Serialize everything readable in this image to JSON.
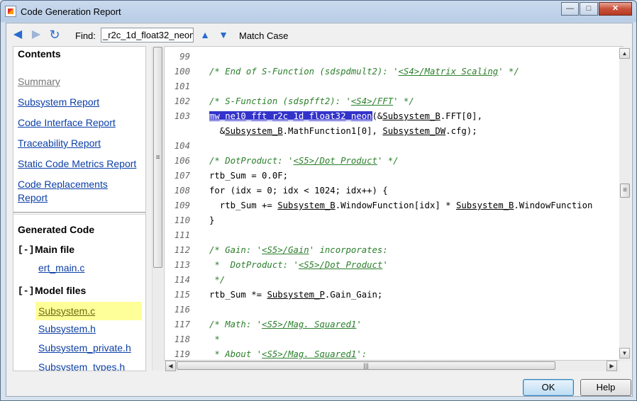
{
  "window": {
    "title": "Code Generation Report",
    "min_label": "—",
    "max_label": "□",
    "close_label": "✕"
  },
  "toolbar": {
    "find_label": "Find:",
    "find_value": "_r2c_1d_float32_neon",
    "match_case_label": "Match Case",
    "back_icon": "◀",
    "forward_icon": "▶",
    "refresh_icon": "↻",
    "up_icon": "▲",
    "down_icon": "▼"
  },
  "contents": {
    "title": "Contents",
    "summary": "Summary",
    "subsystem_report": "Subsystem Report",
    "code_interface_report": "Code Interface Report",
    "traceability_report": "Traceability Report",
    "static_code_metrics_report": "Static Code Metrics Report",
    "code_replacements_line1": "Code Replacements",
    "code_replacements_line2": "Report"
  },
  "generated_code": {
    "title": "Generated Code",
    "main_toggle": "[-]",
    "main_label": "Main file",
    "main_files": [
      "ert_main.c"
    ],
    "model_toggle": "[-]",
    "model_label": "Model files",
    "model_files": [
      "Subsystem.c",
      "Subsystem.h",
      "Subsystem_private.h",
      "Subsystem_types.h"
    ]
  },
  "code": {
    "lines": [
      {
        "n": "99",
        "segs": []
      },
      {
        "n": "100",
        "segs": [
          {
            "t": "/* End of S-Function (sdspdmult2): '",
            "c": "cm"
          },
          {
            "t": "<S4>/Matrix Scaling",
            "c": "cml"
          },
          {
            "t": "' */",
            "c": "cm"
          }
        ]
      },
      {
        "n": "101",
        "segs": []
      },
      {
        "n": "102",
        "segs": [
          {
            "t": "/* S-Function (sdspfft2): '",
            "c": "cm"
          },
          {
            "t": "<S4>/FFT",
            "c": "cml"
          },
          {
            "t": "' */",
            "c": "cm"
          }
        ]
      },
      {
        "n": "103",
        "segs": [
          {
            "t": "mw_ne10_fft_r2c_1d_float32_neon",
            "c": "hl"
          },
          {
            "t": "(&",
            "c": ""
          },
          {
            "t": "Subsystem_B",
            "c": "ul"
          },
          {
            "t": ".FFT[0],",
            "c": ""
          }
        ]
      },
      {
        "n": "",
        "segs": [
          {
            "t": "  &",
            "c": ""
          },
          {
            "t": "Subsystem_B",
            "c": "ul"
          },
          {
            "t": ".MathFunction1[0], ",
            "c": ""
          },
          {
            "t": "Subsystem_DW",
            "c": "ul"
          },
          {
            "t": ".cfg);",
            "c": ""
          }
        ]
      },
      {
        "n": "104",
        "segs": []
      },
      {
        "n": "106",
        "segs": [
          {
            "t": "/* DotProduct: '",
            "c": "cm"
          },
          {
            "t": "<S5>/Dot Product",
            "c": "cml"
          },
          {
            "t": "' */",
            "c": "cm"
          }
        ]
      },
      {
        "n": "107",
        "segs": [
          {
            "t": "rtb_Sum = 0.0F;",
            "c": ""
          }
        ]
      },
      {
        "n": "108",
        "segs": [
          {
            "t": "for (idx = 0; idx < 1024; idx++) {",
            "c": ""
          }
        ]
      },
      {
        "n": "109",
        "segs": [
          {
            "t": "  rtb_Sum += ",
            "c": ""
          },
          {
            "t": "Subsystem_B",
            "c": "ul"
          },
          {
            "t": ".WindowFunction[idx] * ",
            "c": ""
          },
          {
            "t": "Subsystem_B",
            "c": "ul"
          },
          {
            "t": ".WindowFunction",
            "c": ""
          }
        ]
      },
      {
        "n": "110",
        "segs": [
          {
            "t": "}",
            "c": ""
          }
        ]
      },
      {
        "n": "111",
        "segs": []
      },
      {
        "n": "112",
        "segs": [
          {
            "t": "/* Gain: '",
            "c": "cm"
          },
          {
            "t": "<S5>/Gain",
            "c": "cml"
          },
          {
            "t": "' incorporates:",
            "c": "cm"
          }
        ]
      },
      {
        "n": "113",
        "segs": [
          {
            "t": " *  DotProduct: '",
            "c": "cm"
          },
          {
            "t": "<S5>/Dot Product",
            "c": "cml"
          },
          {
            "t": "'",
            "c": "cm"
          }
        ]
      },
      {
        "n": "114",
        "segs": [
          {
            "t": " */",
            "c": "cm"
          }
        ]
      },
      {
        "n": "115",
        "segs": [
          {
            "t": "rtb_Sum *= ",
            "c": ""
          },
          {
            "t": "Subsystem_P",
            "c": "ul"
          },
          {
            "t": ".Gain_Gain;",
            "c": ""
          }
        ]
      },
      {
        "n": "116",
        "segs": []
      },
      {
        "n": "117",
        "segs": [
          {
            "t": "/* Math: '",
            "c": "cm"
          },
          {
            "t": "<S5>/Mag. Squared1",
            "c": "cml"
          },
          {
            "t": "'",
            "c": "cm"
          }
        ]
      },
      {
        "n": "118",
        "segs": [
          {
            "t": " *",
            "c": "cm"
          }
        ]
      },
      {
        "n": "119",
        "segs": [
          {
            "t": " * About '",
            "c": "cm"
          },
          {
            "t": "<S5>/Mag. Squared1",
            "c": "cml"
          },
          {
            "t": "':",
            "c": "cm"
          }
        ]
      }
    ]
  },
  "buttons": {
    "ok": "OK",
    "help": "Help"
  },
  "scroll": {
    "left_thumb_grip": "≡",
    "right_thumb_grip": "≡",
    "h_thumb_grip": "|||",
    "arrow_up": "▲",
    "arrow_down": "▼",
    "arrow_left": "◀",
    "arrow_right": "▶"
  }
}
